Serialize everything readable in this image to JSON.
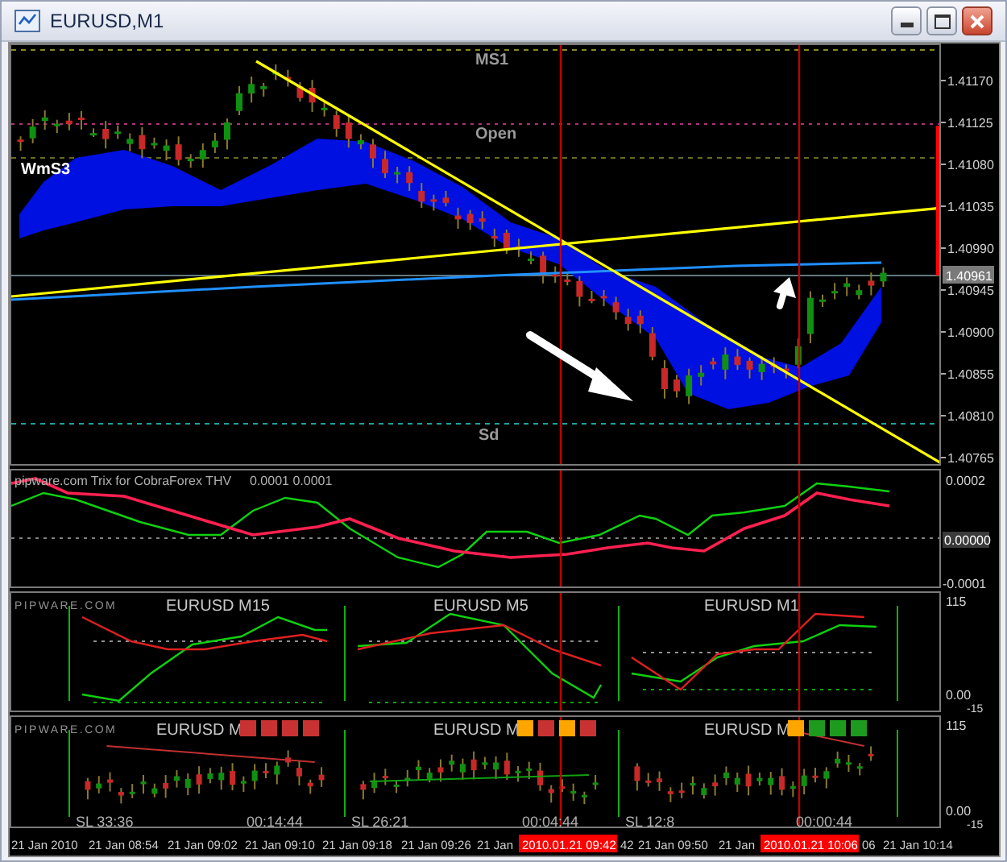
{
  "window": {
    "title": "EURUSD,M1"
  },
  "main_chart": {
    "level_labels": [
      {
        "text": "MS1",
        "kind": "pivot"
      },
      {
        "text": "Open",
        "kind": "pivot"
      },
      {
        "text": "WmS3",
        "kind": "zone"
      },
      {
        "text": "Sd",
        "kind": "pivot"
      }
    ],
    "price_scale": [
      "1.41170",
      "1.41125",
      "1.41080",
      "1.41035",
      "1.40990",
      "1.40945",
      "1.40900",
      "1.40855",
      "1.40810",
      "1.40765"
    ],
    "current_price": "1.40961"
  },
  "trix_panel": {
    "title": "pipware.com Trix for CobraForex THV",
    "parameters": "0.0001 0.0001",
    "scale": [
      "0.0002",
      "0.00000",
      "-0.0001"
    ]
  },
  "mtf_panel": {
    "brand": "PIPWARE.COM",
    "charts": [
      {
        "title": "EURUSD M15"
      },
      {
        "title": "EURUSD M5"
      },
      {
        "title": "EURUSD M1"
      }
    ],
    "scale": [
      "115",
      "0.00",
      "-15"
    ]
  },
  "candle_panel": {
    "brand": "PIPWARE.COM",
    "charts": [
      {
        "title": "EURUSD M",
        "signals": [
          {
            "color": "#c83232"
          },
          {
            "color": "#c83232"
          },
          {
            "color": "#c83232"
          },
          {
            "color": "#c83232"
          }
        ],
        "sl": "SL 33:36",
        "timer": "00:14:44"
      },
      {
        "title": "EURUSD M",
        "signals": [
          {
            "color": "#ffa500"
          },
          {
            "color": "#c83232"
          },
          {
            "color": "#ffa500"
          },
          {
            "color": "#c83232"
          }
        ],
        "sl": "SL 26:21",
        "timer": "00:04:44"
      },
      {
        "title": "EURUSD M",
        "signals": [
          {
            "color": "#ffa500"
          },
          {
            "color": "#1e9a1e"
          },
          {
            "color": "#1e9a1e"
          },
          {
            "color": "#1e9a1e"
          }
        ],
        "sl": "SL 12:8",
        "timer": "00:00:44"
      }
    ],
    "scale": [
      "115",
      "0.00",
      "-15"
    ]
  },
  "time_axis": [
    {
      "kind": "label",
      "text": "21 Jan 2010"
    },
    {
      "kind": "label",
      "text": "21 Jan 08:54"
    },
    {
      "kind": "label",
      "text": "21 Jan 09:02"
    },
    {
      "kind": "label",
      "text": "21 Jan 09:10"
    },
    {
      "kind": "label",
      "text": "21 Jan 09:18"
    },
    {
      "kind": "label",
      "text": "21 Jan 09:26"
    },
    {
      "kind": "label",
      "text": "21 Jan"
    },
    {
      "kind": "marker",
      "text": "2010.01.21 09:42"
    },
    {
      "kind": "label",
      "text": "42"
    },
    {
      "kind": "label",
      "text": "21 Jan 09:50"
    },
    {
      "kind": "label",
      "text": "21 Jan"
    },
    {
      "kind": "marker",
      "text": "2010.01.21 10:06"
    },
    {
      "kind": "label",
      "text": "06"
    },
    {
      "kind": "label",
      "text": "21 Jan 10:14"
    }
  ]
}
